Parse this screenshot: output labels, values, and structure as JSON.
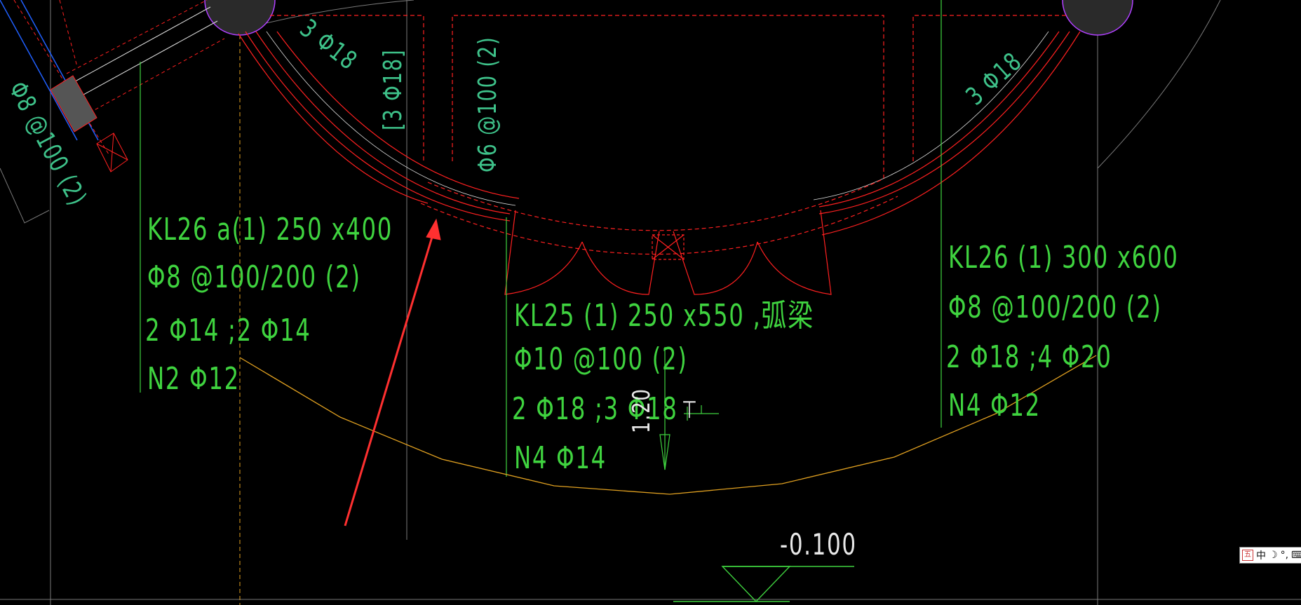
{
  "drawing": {
    "beams": [
      {
        "id": "kl26a",
        "lines": [
          "KL26 a(1) 250 x400",
          "Φ8 @100/200 (2)",
          "2 Φ14 ;2 Φ14",
          "N2 Φ12"
        ]
      },
      {
        "id": "kl25",
        "lines": [
          "KL25 (1) 250 x550 ,弧梁",
          "Φ10 @100 (2)",
          "2 Φ18 ;3 Φ18",
          "N4 Φ14"
        ]
      },
      {
        "id": "kl26",
        "lines": [
          "KL26 (1) 300 x600",
          "Φ8 @100/200 (2)",
          "2 Φ18 ;4 Φ20",
          "N4 Φ12"
        ]
      }
    ],
    "rebar_notes": {
      "left_stirrup": "Φ8 @100 (2)",
      "arc_top_left": "3 Φ18",
      "box_left": "[3 Φ18]",
      "stirrup_center": "Φ6 @100 (2)",
      "arc_top_right": "3 Φ18"
    },
    "elevation": "-0.100",
    "dim_value": "1.20",
    "slope_mark": "⊤"
  },
  "ime_bar": {
    "mode": "中"
  },
  "colors": {
    "beam_red": "#ff2020",
    "annot_green": "#3fd33f",
    "rebar_cyan": "#3ec28a",
    "guide_orange": "#e0a020",
    "arrow": "#ff3030"
  }
}
